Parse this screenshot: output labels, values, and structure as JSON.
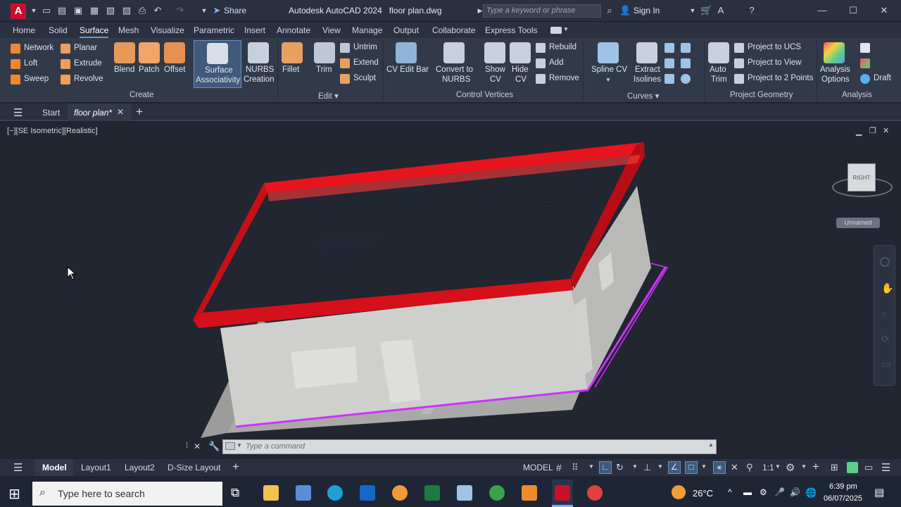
{
  "window": {
    "app_title": "Autodesk AutoCAD 2024",
    "file_name": "floor plan.dwg",
    "share": "Share",
    "search_placeholder": "Type a keyword or phrase",
    "sign_in": "Sign In"
  },
  "menu": [
    "Home",
    "Solid",
    "Surface",
    "Mesh",
    "Visualize",
    "Parametric",
    "Insert",
    "Annotate",
    "View",
    "Manage",
    "Output",
    "Collaborate",
    "Express Tools"
  ],
  "ribbon": {
    "create": {
      "title": "Create",
      "network": "Network",
      "planar": "Planar",
      "loft": "Loft",
      "extrude": "Extrude",
      "sweep": "Sweep",
      "revolve": "Revolve",
      "blend": "Blend",
      "patch": "Patch",
      "offset": "Offset",
      "surface_assoc_1": "Surface",
      "surface_assoc_2": "Associativity",
      "nurbs_1": "NURBS",
      "nurbs_2": "Creation"
    },
    "edit": {
      "title": "Edit",
      "fillet": "Fillet",
      "trim": "Trim",
      "untrim": "Untrim",
      "extend": "Extend",
      "sculpt": "Sculpt"
    },
    "control_vertices": {
      "title": "Control Vertices",
      "cv_edit_bar": "CV Edit Bar",
      "convert_1": "Convert to",
      "convert_2": "NURBS",
      "show_1": "Show",
      "show_2": "CV",
      "hide_1": "Hide",
      "hide_2": "CV",
      "rebuild": "Rebuild",
      "add": "Add",
      "remove": "Remove"
    },
    "curves": {
      "title": "Curves",
      "spline_cv": "Spline CV",
      "extract_1": "Extract",
      "extract_2": "Isolines"
    },
    "project_geometry": {
      "title": "Project Geometry",
      "auto_1": "Auto",
      "auto_2": "Trim",
      "project_ucs": "Project to UCS",
      "project_view": "Project to View",
      "project_2pts": "Project to 2 Points"
    },
    "analysis": {
      "title": "Analysis",
      "options_1": "Analysis",
      "options_2": "Options",
      "draft": "Draft"
    }
  },
  "tabs": {
    "start": "Start",
    "active": "floor plan*"
  },
  "viewport": {
    "label": "[−][SE Isometric][Realistic]",
    "viewcube_face": "RIGHT",
    "ucs_name": "Unnamed"
  },
  "command": {
    "placeholder": "Type a command"
  },
  "layouts": [
    "Model",
    "Layout1",
    "Layout2",
    "D-Size Layout"
  ],
  "status": {
    "space": "MODEL",
    "scale": "1:1"
  },
  "taskbar": {
    "search": "Type here to search",
    "temperature": "26°C",
    "time": "6:39 pm",
    "date": "06/07/2025"
  },
  "colors": {
    "accent": "#5a9bd8",
    "frame_red": "#d4101a",
    "magenta": "#cc33ff"
  }
}
